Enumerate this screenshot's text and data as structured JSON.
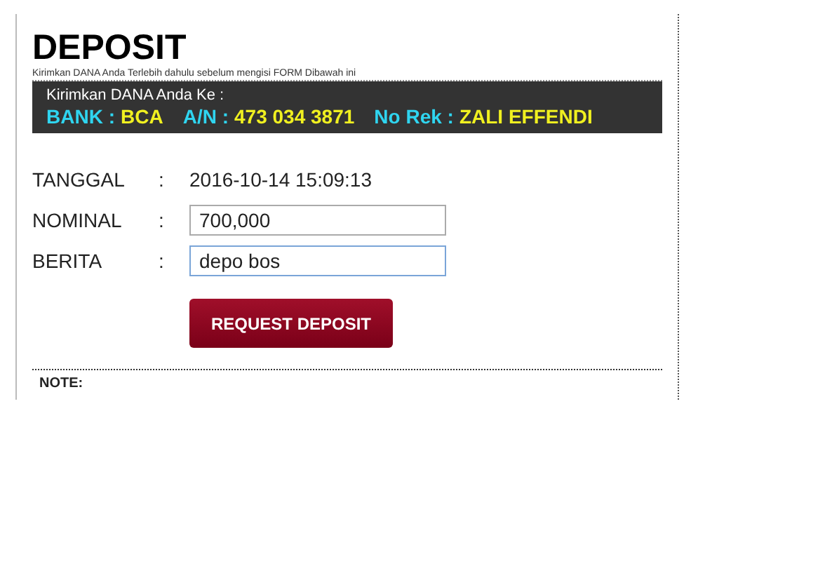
{
  "title": "DEPOSIT",
  "subtitle": "Kirimkan DANA Anda Terlebih dahulu sebelum mengisi FORM Dibawah ini",
  "bank_box": {
    "heading": "Kirimkan DANA Anda Ke :",
    "details": [
      {
        "label": "BANK :",
        "value": "BCA"
      },
      {
        "label": "A/N :",
        "value": "473 034 3871"
      },
      {
        "label": "No Rek :",
        "value": "ZALI EFFENDI"
      }
    ]
  },
  "form": [
    {
      "kind": "text",
      "label": "TANGGAL",
      "separator": ":",
      "value": "2016-10-14 15:09:13"
    },
    {
      "kind": "input",
      "label": "NOMINAL",
      "separator": ":",
      "value": "700,000",
      "focused": false
    },
    {
      "kind": "input",
      "label": "BERITA",
      "separator": ":",
      "value": "depo bos",
      "focused": true
    }
  ],
  "submit_button": "REQUEST DEPOSIT",
  "note": {
    "heading": "NOTE:"
  }
}
